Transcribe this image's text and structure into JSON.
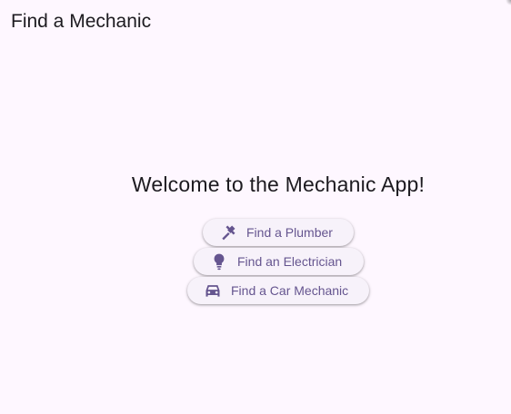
{
  "app_bar": {
    "title": "Find a Mechanic"
  },
  "main": {
    "welcome": "Welcome to the Mechanic App!",
    "buttons": [
      {
        "label": "Find a Plumber",
        "icon": "plumbing-wrench-icon"
      },
      {
        "label": "Find an Electrician",
        "icon": "lightbulb-icon"
      },
      {
        "label": "Find a Car Mechanic",
        "icon": "car-icon"
      }
    ]
  },
  "colors": {
    "background": "#fef7ff",
    "button_background": "#f7f2fa",
    "accent": "#65558f",
    "text": "#1d1b20"
  }
}
